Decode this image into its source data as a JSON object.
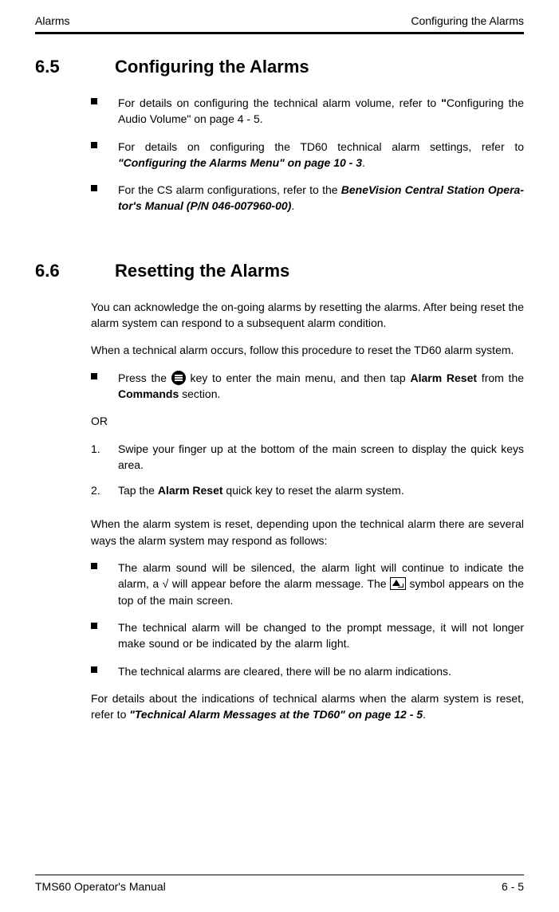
{
  "header": {
    "left": "Alarms",
    "right": "Configuring the Alarms"
  },
  "section65": {
    "num": "6.5",
    "title": "Configuring the Alarms",
    "bullets": {
      "b1a": "For details on configuring the technical alarm volume, refer to ",
      "b1q": "\"",
      "b1b": "Configuring the Audio Volume\" on page 4 - 5",
      "b1c": ".",
      "b2a": "For details on configuring the TD60 technical alarm settings, refer to ",
      "b2b": "\"Configuring the Alarms Menu\" on page 10 - 3",
      "b2c": ".",
      "b3a": "For the CS alarm configurations, refer to the ",
      "b3b": "BeneVision Central Station Opera­tor's Manual (P/N 046-007960-00)",
      "b3c": "."
    }
  },
  "section66": {
    "num": "6.6",
    "title": "Resetting the Alarms",
    "para1": "You can acknowledge the on-going alarms by resetting the alarms. After being reset the alarm system can respond to a subsequent alarm condition.",
    "para2": "When a technical alarm occurs, follow this procedure to reset the TD60 alarm system.",
    "press": {
      "a": "Press the ",
      "b": " key to enter the main menu, and then tap ",
      "c": "Alarm Reset",
      "d": " from the ",
      "e": "Commands",
      "f": " section."
    },
    "or": "OR",
    "steps": {
      "n1": "1.",
      "s1": "Swipe your finger up at the bottom of the main screen to display the quick keys area.",
      "n2": "2.",
      "s2a": "Tap the ",
      "s2b": "Alarm Reset",
      "s2c": " quick key to reset the alarm system."
    },
    "para3": "When the alarm system is reset, depending upon the technical alarm there are several ways the alarm system may respond as follows:",
    "resp": {
      "r1a": "The alarm sound will be silenced, the alarm light will continue to indicate the alarm, a √ will appear before the alarm message. The ",
      "r1b": " symbol appears on the top of the main screen.",
      "r2": "The technical alarm will be changed to the prompt message, it will not longer make sound or be indicated by the alarm light.",
      "r3": "The technical alarms are cleared, there will be no alarm indications."
    },
    "para4a": "For details about the indications of technical alarms when the alarm system is reset, refer to ",
    "para4b": "\"Technical Alarm Messages at the TD60\" on page 12 - 5",
    "para4c": "."
  },
  "footer": {
    "left": "TMS60 Operator's Manual",
    "right": "6 - 5"
  }
}
